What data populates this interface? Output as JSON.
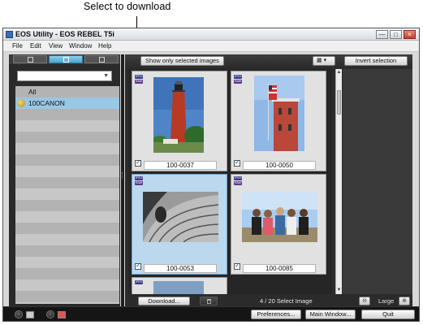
{
  "callout": {
    "text": "Select to download"
  },
  "window": {
    "title": "EOS Utility - EOS REBEL T5i",
    "controls": [
      "minimize",
      "maximize",
      "close"
    ]
  },
  "menu": [
    "File",
    "Edit",
    "View",
    "Window",
    "Help"
  ],
  "sidebar": {
    "tabs": [
      "tab-left",
      "tab-middle",
      "tab-right"
    ],
    "active_tab": 1,
    "folder_select_value": "",
    "folders": [
      {
        "label": "All",
        "selected": false
      },
      {
        "label": "100CANON",
        "selected": true
      }
    ]
  },
  "toolbar": {
    "show_selected_label": "Show only selected images",
    "invert_label": "Invert selection"
  },
  "thumbnails": [
    {
      "filename": "100-0037",
      "checked": true,
      "selected": false,
      "badges": [
        "JPEG",
        "RAW"
      ]
    },
    {
      "filename": "100-0050",
      "checked": true,
      "selected": false,
      "badges": [
        "JPEG",
        "RAW"
      ]
    },
    {
      "filename": "100-0053",
      "checked": true,
      "selected": true,
      "badges": [
        "JPEG",
        "RAW"
      ]
    },
    {
      "filename": "100-0085",
      "checked": true,
      "selected": false,
      "badges": [
        "JPEG",
        "RAW"
      ]
    }
  ],
  "bottombar": {
    "download_label": "Download...",
    "status": "4 / 20 Select Image",
    "zoom_label": "Large"
  },
  "footer": {
    "preferences_label": "Preferences...",
    "main_window_label": "Main Window...",
    "quit_label": "Quit"
  },
  "colors": {
    "selection_blue": "#99c7e6",
    "dark_panel": "#2b2b2b"
  }
}
